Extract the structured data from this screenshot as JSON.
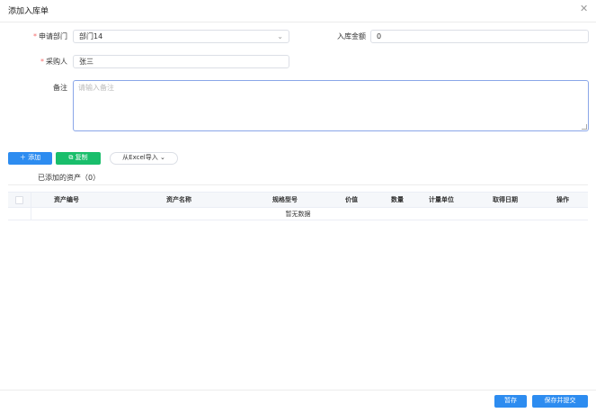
{
  "dialog": {
    "title": "添加入库单"
  },
  "form": {
    "department": {
      "label": "申请部门",
      "value": "部门14"
    },
    "amount": {
      "label": "入库金额",
      "value": "0"
    },
    "purchaser": {
      "label": "采购人",
      "value": "张三"
    },
    "remark": {
      "label": "备注",
      "placeholder": "请输入备注"
    }
  },
  "toolbar": {
    "add_label": "添加",
    "copy_label": "复制",
    "import_label": "从Excel导入"
  },
  "assets": {
    "section_title": "已添加的资产（0）",
    "columns": [
      "资产编号",
      "资产名称",
      "规格型号",
      "价值",
      "数量",
      "计量单位",
      "取得日期",
      "操作"
    ],
    "empty_text": "暂无数据"
  },
  "footer": {
    "save_draft_label": "暂存",
    "save_submit_label": "保存并提交"
  },
  "colors": {
    "primary": "#2d8cf0",
    "success": "#19be6b",
    "required": "#f56c6c"
  }
}
